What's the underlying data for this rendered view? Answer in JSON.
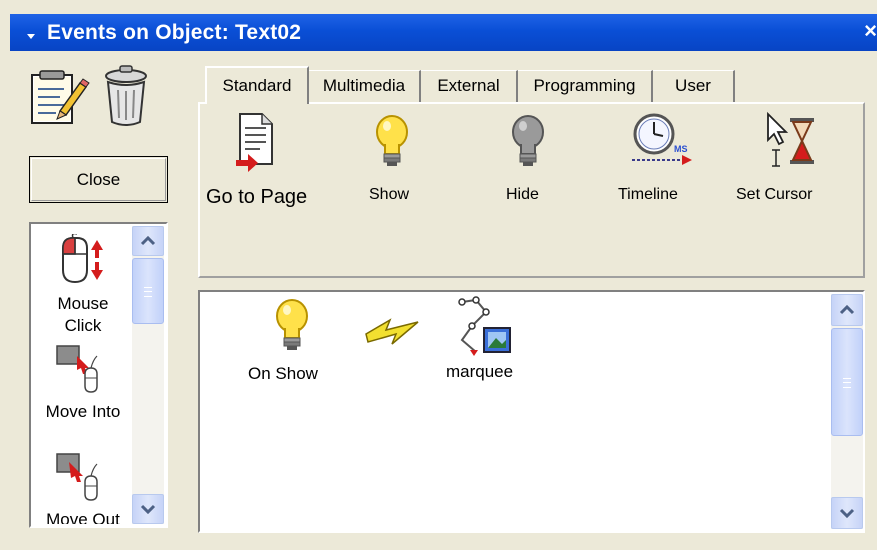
{
  "window": {
    "title": "Events on Object: Text02",
    "close_glyph": "×"
  },
  "toolbar": {
    "properties_icon": "notepad-pencil-icon",
    "delete_icon": "trash-can-icon"
  },
  "close_button": {
    "label": "Close"
  },
  "events": [
    {
      "label": "Mouse Click",
      "line1": "Mouse",
      "line2": "Click",
      "icon": "mouse-click-icon"
    },
    {
      "label": "Move Into",
      "icon": "move-into-icon"
    },
    {
      "label": "Move Out",
      "icon": "move-out-icon"
    }
  ],
  "tabs": [
    {
      "label": "Standard",
      "active": true
    },
    {
      "label": "Multimedia",
      "active": false
    },
    {
      "label": "External",
      "active": false
    },
    {
      "label": "Programming",
      "active": false
    },
    {
      "label": "User",
      "active": false
    }
  ],
  "actions": [
    {
      "label": "Go to Page",
      "icon": "page-arrow-icon"
    },
    {
      "label": "Show",
      "icon": "lightbulb-on-icon"
    },
    {
      "label": "Hide",
      "icon": "lightbulb-off-icon"
    },
    {
      "label": "Timeline",
      "icon": "clock-timeline-icon"
    },
    {
      "label": "Set Cursor",
      "icon": "cursor-hourglass-icon"
    }
  ],
  "canvas": {
    "event_label": "On Show",
    "event_icon": "lightbulb-on-icon",
    "link_icon": "lightning-bolt-icon",
    "target_label": "marquee",
    "target_icon": "marquee-path-icon"
  },
  "colors": {
    "titlebar": "#0a4fd6",
    "window_bg": "#ece9d8",
    "scroll_accent": "#c6d3f7"
  }
}
